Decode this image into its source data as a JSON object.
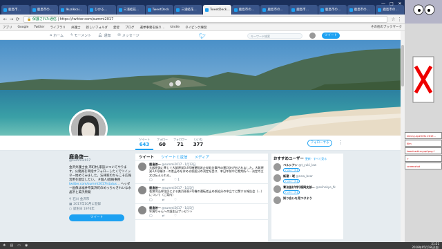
{
  "tabs": [
    "鹿島市…",
    "鹿島市の…",
    "Ikuzikkai…",
    "ひかる…",
    "三浦結花…",
    "TweetDeck",
    "三浦結花…",
    "TweetDeck…",
    "鹿島市の…",
    "鹿島市の…",
    "鹿島市…",
    "鹿島市の…",
    "鹿島市の…",
    "鹿島市の…"
  ],
  "active_tab_index": 7,
  "window_controls": [
    "—",
    "□",
    "✕"
  ],
  "address": {
    "secure_label": "保護された通信",
    "url": "https://twitter.com/summi2017"
  },
  "bookmarks": [
    "アプリ",
    "Google",
    "Twitter",
    "ライブラリ",
    "弁護士",
    "新しいフォルダ",
    "愛智",
    "ブログ",
    "選挙事務を振り…",
    "kindle",
    "タイピング練習"
  ],
  "bookmarks_other": "その他のブックマーク",
  "twnav": {
    "home": "ホーム",
    "moments": "モーメント",
    "notifications": "通知",
    "messages": "メッセージ",
    "search_placeholder": "キーワード検索",
    "tweet_button": "ツイート"
  },
  "stats": [
    {
      "label": "ツイート",
      "value": "643"
    },
    {
      "label": "フォロー",
      "value": "60"
    },
    {
      "label": "フォロワー",
      "value": "71"
    },
    {
      "label": "いいね",
      "value": "377"
    }
  ],
  "follow_button": "フォローする",
  "profile": {
    "name": "鹿島啓一",
    "handle": "@summi2017",
    "bio": "金沢弁護士会,市町村,家族についてやります。公務員を目指すフォローしたくでツイッター始めてみました。法律家のからこそ広報活用を配信したい。 #個人/鹿嶋事務",
    "bio_link": "twitter.com/summi2017/status…",
    "bio_tail": "ヘッダー画像は福井県美浜町のめっちゃきれいな水晶浜と美浜原発",
    "location": "石川 金沢市",
    "joined": "2017年10月に登録",
    "born": "誕生日 1976年",
    "tweet_button": "ツイート"
  },
  "timeline": {
    "tabs": [
      "ツイート",
      "ツイートと返信",
      "メディア"
    ],
    "tweets": [
      {
        "name": "鹿島啓一",
        "handle": "@summi2017 · 1月12日",
        "text": "大飯原発に準じて大飯原発3,4号機運転差止仮処分事件の異判決が出されました。大飯原発3,4号機は…の差止めを求める仮処分の決定を受け、本日午前中に裁判所へ…決定の主文は伝えられる。",
        "acts": [
          "◯",
          "⇄",
          "♡ 1"
        ]
      },
      {
        "name": "鹿島啓一",
        "handle": "@summi2017 · 1月5日",
        "text": "若狭湾沿岸住民による美浜原発3号機の運転差止め仮処分の申立てに関する報告会（…）について（ご案内）",
        "acts": [
          "◯",
          "⇄",
          "♡"
        ]
      },
      {
        "name": "鹿島啓一",
        "handle": "@summi2017 · 1月5日",
        "text": "年賀ちゃんへの誕生日プレゼント",
        "acts": [
          "◯",
          "⇄",
          "♡"
        ]
      }
    ]
  },
  "who_to_follow": {
    "title": "おすすめユーザー",
    "refresh": "更新 · すべて見る",
    "users": [
      {
        "name": "ペルシアン",
        "handle": "@t_yuki_law",
        "button": "フォローする"
      },
      {
        "name": "新潮 · 咲",
        "handle": "@new_bear",
        "button": "フォローする"
      },
      {
        "name": "青法協(弁学)福岡支部…",
        "handle": "@seihokyo_fk",
        "button": "フォローする"
      },
      {
        "name": "知り合いを見つけよう",
        "handle": "",
        "button": ""
      }
    ]
  },
  "right_panel_windows": [
    "kimmy-ep2019x 2019…",
    "Kim",
    "tweet-add-myqsf-png.f",
    "+",
    "screenshot"
  ],
  "clock": {
    "time": "21:51",
    "date": "2018年05月18日(金)"
  },
  "colors": {
    "twitter_blue": "#1da1f2",
    "chrome_tabbar": "#1a2f5a"
  }
}
